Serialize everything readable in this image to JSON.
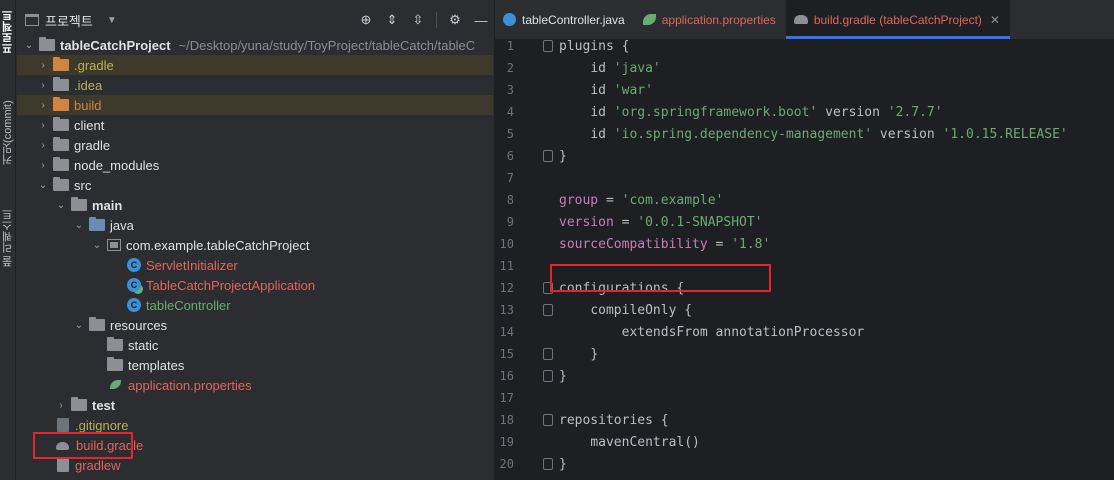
{
  "sidebar": {
    "tabs": [
      {
        "label": "프로젝트",
        "active": true
      },
      {
        "label": "커밋(commit)",
        "active": false
      },
      {
        "label": "풀 리퀘스트",
        "active": false
      }
    ]
  },
  "project_panel": {
    "title": "프로젝트",
    "tools": [
      "locate-icon",
      "expand-all-icon",
      "collapse-all-icon",
      "gear-icon",
      "hide-icon"
    ],
    "root": {
      "name": "tableCatchProject",
      "path": "~/Desktop/yuna/study/ToyProject/tableCatch/tableC"
    },
    "items": [
      {
        "label": ".gradle"
      },
      {
        "label": ".idea"
      },
      {
        "label": "build"
      },
      {
        "label": "client"
      },
      {
        "label": "gradle"
      },
      {
        "label": "node_modules"
      },
      {
        "label": "src"
      },
      {
        "label": "main"
      },
      {
        "label": "java"
      },
      {
        "label": "com.example.tableCatchProject"
      },
      {
        "label": "ServletInitializer"
      },
      {
        "label": "TableCatchProjectApplication"
      },
      {
        "label": "tableController"
      },
      {
        "label": "resources"
      },
      {
        "label": "static"
      },
      {
        "label": "templates"
      },
      {
        "label": "application.properties"
      },
      {
        "label": "test"
      },
      {
        "label": ".gitignore"
      },
      {
        "label": "build.gradle"
      },
      {
        "label": "gradlew"
      }
    ]
  },
  "editor": {
    "tabs": [
      {
        "label": "tableController.java",
        "icon": "java-class-icon",
        "active": false
      },
      {
        "label": "application.properties",
        "icon": "spring-leaf-icon",
        "active": false
      },
      {
        "label": "build.gradle (tableCatchProject)",
        "icon": "gradle-icon",
        "active": true
      }
    ],
    "line_numbers": [
      "1",
      "2",
      "3",
      "4",
      "5",
      "6",
      "7",
      "8",
      "9",
      "10",
      "11",
      "12",
      "13",
      "14",
      "15",
      "16",
      "17",
      "18",
      "19",
      "20"
    ],
    "code": {
      "l1_kw": "plugins",
      "l1_b": " {",
      "l2_id": "id ",
      "l2_s": "'java'",
      "l3_id": "id ",
      "l3_s": "'war'",
      "l4_id": "id ",
      "l4_s": "'org.springframework.boot'",
      "l4_v": " version ",
      "l4_s2": "'2.7.7'",
      "l5_id": "id ",
      "l5_s": "'io.spring.dependency-management'",
      "l5_v": " version ",
      "l5_s2": "'1.0.15.RELEASE'",
      "l6": "}",
      "l8_f": "group",
      "l8_eq": " = ",
      "l8_s": "'com.example'",
      "l9_f": "version",
      "l9_eq": " = ",
      "l9_s": "'0.0.1-SNAPSHOT'",
      "l10_f": "sourceCompatibility",
      "l10_eq": " = ",
      "l10_s": "'1.8'",
      "l12": "configurations {",
      "l13": "compileOnly {",
      "l14": "extendsFrom annotationProcessor",
      "l15": "}",
      "l16": "}",
      "l18": "repositories {",
      "l19": "mavenCentral()",
      "l20": "}"
    }
  },
  "colors": {
    "highlight_box": "#e4252d",
    "active_tab_underline": "#3574f0",
    "excluded_folder": "#d08642"
  }
}
